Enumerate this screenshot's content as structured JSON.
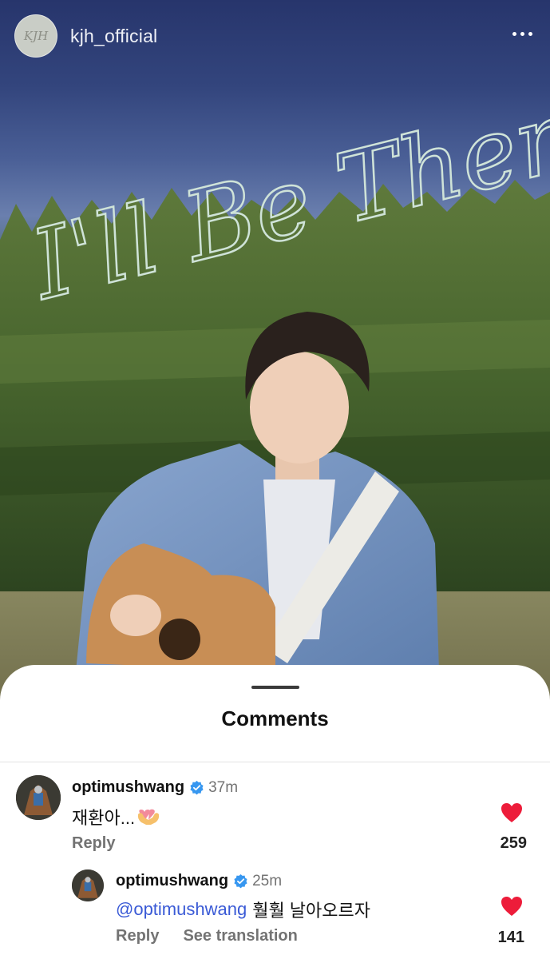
{
  "post": {
    "username": "kjh_official",
    "avatar_monogram": "KJH",
    "photo_title": "I'll Be There"
  },
  "icons": {
    "more": "more-horizontal-icon",
    "verified": "verified-badge-icon",
    "like": "heart-filled-icon"
  },
  "colors": {
    "heart": "#ed1c3a",
    "verified": "#3797f0",
    "mention": "#3a5ad6",
    "secondary_text": "#737373"
  },
  "sheet": {
    "title": "Comments"
  },
  "comments": [
    {
      "username": "optimushwang",
      "verified": true,
      "time": "37m",
      "text": "재환아...",
      "emoji": "heart-hands-emoji",
      "reply_label": "Reply",
      "likes": "259"
    },
    {
      "username": "optimushwang",
      "verified": true,
      "time": "25m",
      "mention": "@optimushwang",
      "text": "훨훨 날아오르자",
      "reply_label": "Reply",
      "translate_label": "See translation",
      "likes": "141"
    }
  ]
}
